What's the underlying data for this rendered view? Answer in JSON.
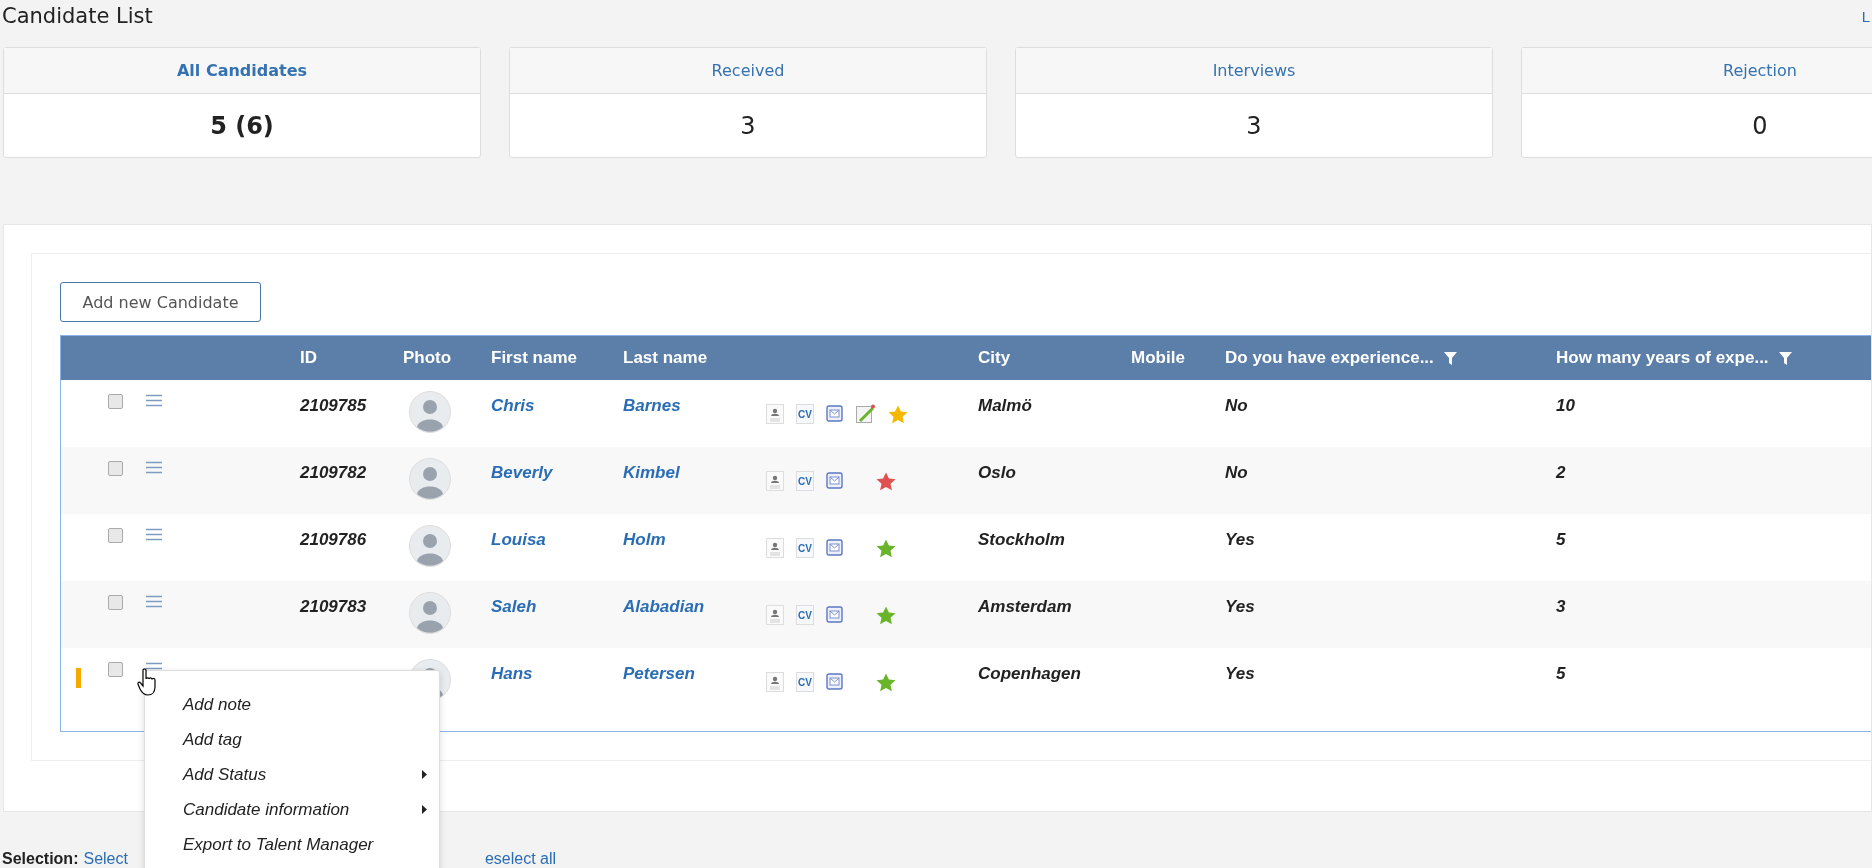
{
  "page": {
    "title": "Candidate List",
    "corner_link": "L"
  },
  "stats": [
    {
      "label": "All Candidates",
      "value": "5 (6)",
      "selected": true
    },
    {
      "label": "Received",
      "value": "3",
      "selected": false
    },
    {
      "label": "Interviews",
      "value": "3",
      "selected": false
    },
    {
      "label": "Rejection",
      "value": "0",
      "selected": false
    }
  ],
  "add_button": "Add new Candidate",
  "table": {
    "columns": [
      {
        "label": "ID",
        "filter": false
      },
      {
        "label": "Photo",
        "filter": false
      },
      {
        "label": "First name",
        "filter": false
      },
      {
        "label": "Last name",
        "filter": false
      },
      {
        "label": "City",
        "filter": false
      },
      {
        "label": "Mobile",
        "filter": false
      },
      {
        "label": "Do you have experience...",
        "filter": true
      },
      {
        "label": "How many years of expe...",
        "filter": true
      }
    ],
    "rows": [
      {
        "checked": false,
        "flagged": false,
        "id": "2109785",
        "first_name": "Chris",
        "last_name": "Barnes",
        "cv_label": "CV",
        "edited": true,
        "color": "#f5b700",
        "city": "Malmö",
        "experience": "No",
        "years": "10"
      },
      {
        "checked": false,
        "flagged": false,
        "id": "2109782",
        "first_name": "Beverly",
        "last_name": "Kimbel",
        "cv_label": "CV",
        "edited": false,
        "color": "#e05050",
        "city": "Oslo",
        "experience": "No",
        "years": "2"
      },
      {
        "checked": false,
        "flagged": false,
        "id": "2109786",
        "first_name": "Louisa",
        "last_name": "Holm",
        "cv_label": "CV",
        "edited": false,
        "color": "#6ab42a",
        "city": "Stockholm",
        "experience": "Yes",
        "years": "5"
      },
      {
        "checked": false,
        "flagged": false,
        "id": "2109783",
        "first_name": "Saleh",
        "last_name": "Alabadian",
        "cv_label": "CV",
        "edited": false,
        "color": "#6ab42a",
        "city": "Amsterdam",
        "experience": "Yes",
        "years": "3"
      },
      {
        "checked": false,
        "flagged": true,
        "first_name": "Hans",
        "last_name": "Petersen",
        "cv_label": "CV",
        "edited": false,
        "color": "#6ab42a",
        "city": "Copenhagen",
        "experience": "Yes",
        "years": "5"
      }
    ]
  },
  "context_menu": {
    "items": [
      {
        "label": "Add note",
        "submenu": false
      },
      {
        "label": "Add tag",
        "submenu": false
      },
      {
        "label": "Add Status",
        "submenu": true
      },
      {
        "label": "Candidate information",
        "submenu": true
      },
      {
        "label": "Export to Talent Manager",
        "submenu": false
      }
    ]
  },
  "selection": {
    "label": "Selection:",
    "links": [
      "Select",
      "eselect all"
    ]
  }
}
